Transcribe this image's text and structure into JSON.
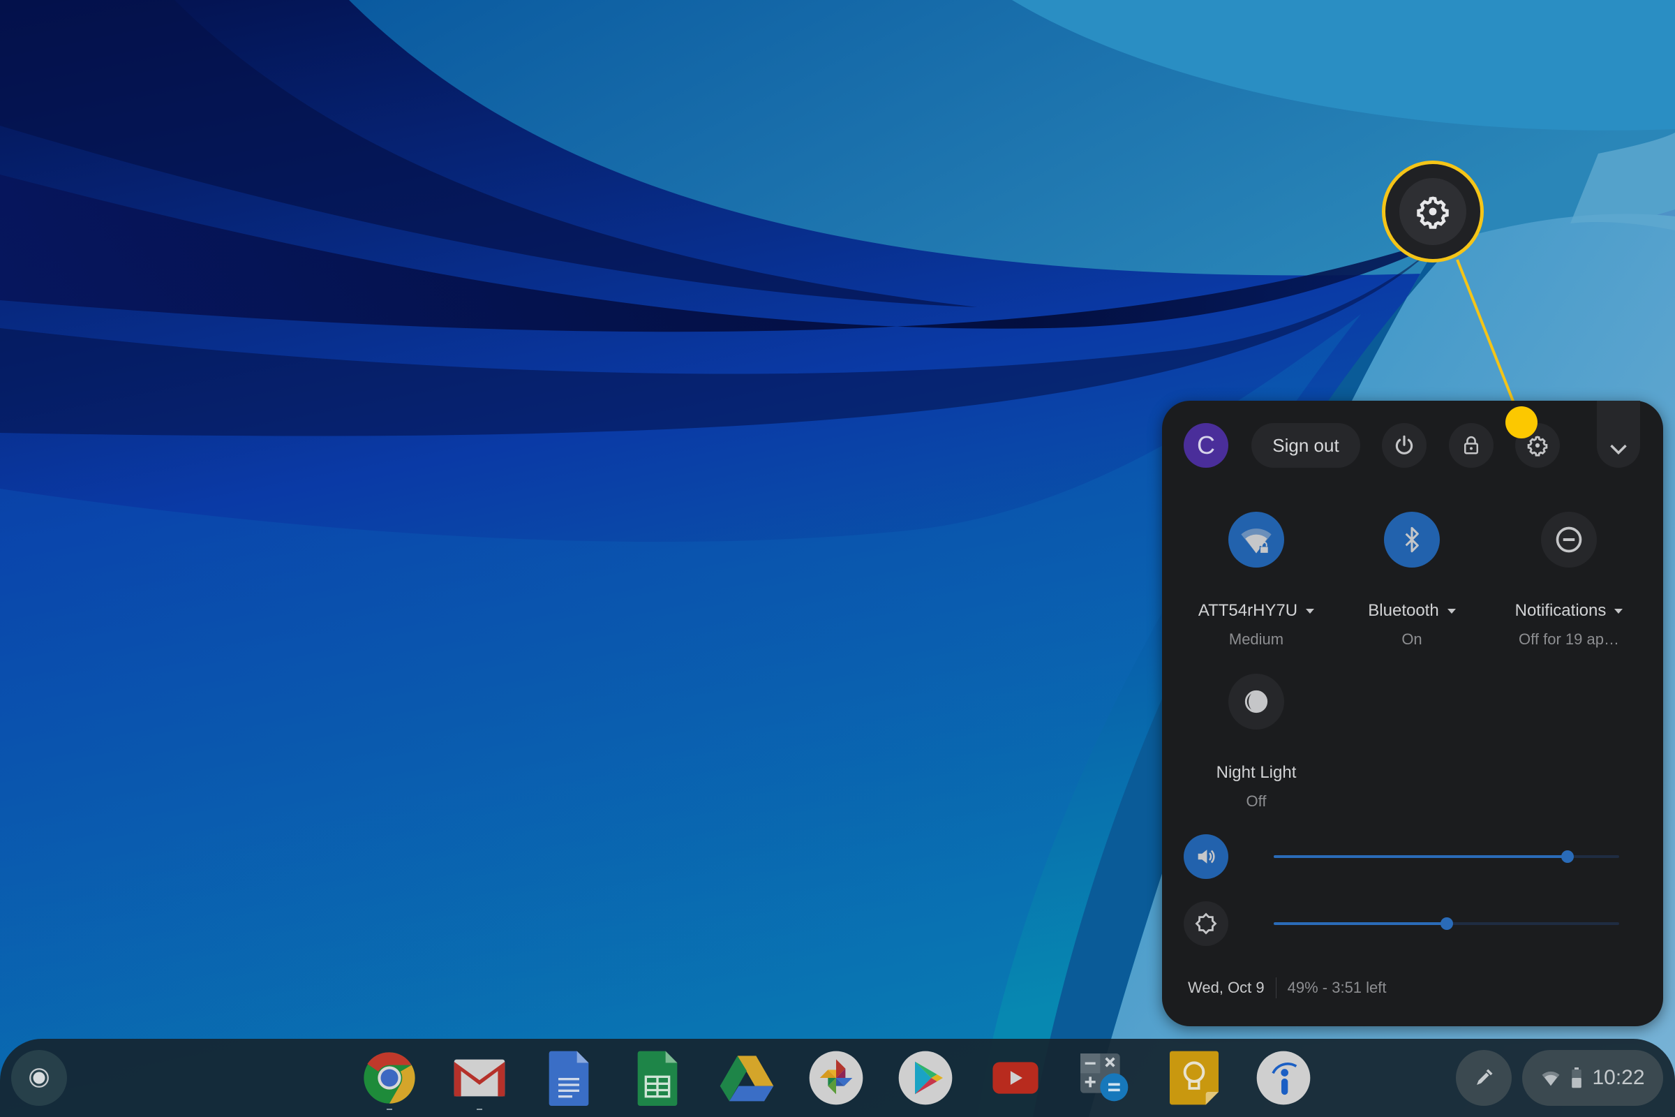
{
  "system_tray": {
    "avatar_initial": "C",
    "sign_out_label": "Sign out",
    "top_buttons": [
      {
        "name": "power",
        "icon": "power-icon"
      },
      {
        "name": "lock",
        "icon": "lock-icon"
      },
      {
        "name": "settings",
        "icon": "gear-icon"
      },
      {
        "name": "collapse",
        "icon": "chevron-down-icon"
      }
    ],
    "feature_tiles": [
      {
        "label": "ATT54rHY7U",
        "sublabel": "Medium",
        "icon": "wifi-lock-icon",
        "state": "on",
        "has_dropdown": true
      },
      {
        "label": "Bluetooth",
        "sublabel": "On",
        "icon": "bluetooth-icon",
        "state": "on",
        "has_dropdown": true
      },
      {
        "label": "Notifications",
        "sublabel": "Off for 19 ap…",
        "icon": "do-not-disturb-icon",
        "state": "off",
        "has_dropdown": true
      },
      {
        "label": "Night Light",
        "sublabel": "Off",
        "icon": "night-light-icon",
        "state": "off",
        "has_dropdown": false
      }
    ],
    "sliders": {
      "volume": {
        "icon": "volume-icon",
        "value_percent": 85
      },
      "brightness": {
        "icon": "brightness-icon",
        "value_percent": 50
      }
    },
    "date": "Wed, Oct 9",
    "battery_status": "49% - 3:51 left"
  },
  "callout": {
    "highlighted": "settings",
    "icon": "gear-icon",
    "color": "#f5c518"
  },
  "shelf": {
    "launcher_icon": "launcher-icon",
    "apps": [
      {
        "name": "Chrome",
        "icon": "chrome-icon",
        "running": true
      },
      {
        "name": "Gmail",
        "icon": "gmail-icon",
        "running": true
      },
      {
        "name": "Docs",
        "icon": "docs-icon",
        "running": false
      },
      {
        "name": "Sheets",
        "icon": "sheets-icon",
        "running": false
      },
      {
        "name": "Drive",
        "icon": "drive-icon",
        "running": false
      },
      {
        "name": "Photos",
        "icon": "photos-icon",
        "running": false
      },
      {
        "name": "Play Store",
        "icon": "play-store-icon",
        "running": false
      },
      {
        "name": "YouTube",
        "icon": "youtube-icon",
        "running": false
      },
      {
        "name": "Calculator",
        "icon": "calculator-icon",
        "running": false
      },
      {
        "name": "Keep",
        "icon": "keep-icon",
        "running": false
      },
      {
        "name": "Info",
        "icon": "info-app-icon",
        "running": false
      }
    ],
    "stylus_icon": "stylus-icon",
    "clock": "10:22",
    "status_icons": [
      "wifi-icon",
      "battery-icon"
    ]
  },
  "colors": {
    "accent_blue": "#2262ad",
    "panel_bg": "#1b1c1e",
    "avatar_purple": "#4a2e9a",
    "callout_yellow": "#f5c518"
  }
}
